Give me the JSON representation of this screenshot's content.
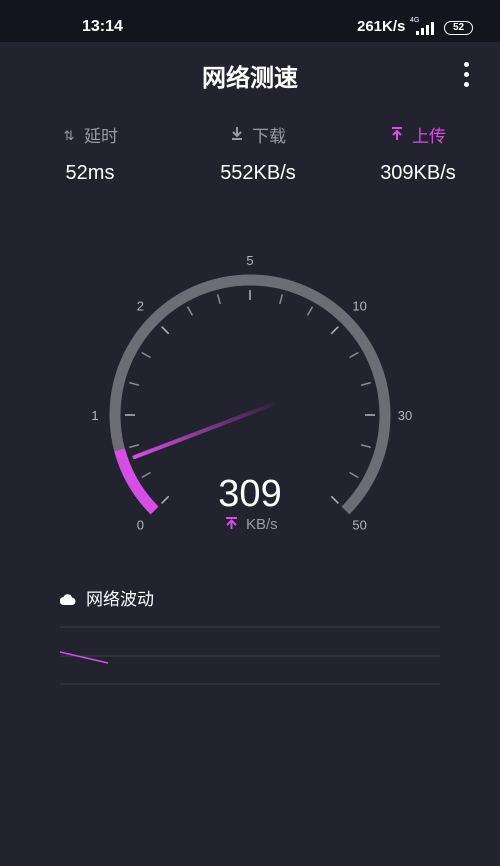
{
  "status_bar": {
    "time": "13:14",
    "net_speed": "261K/s",
    "network_type": "4G",
    "battery": "52"
  },
  "header": {
    "title": "网络测速"
  },
  "stats": {
    "latency": {
      "label": "延时",
      "value": "52ms",
      "icon": "latency-arrows-icon"
    },
    "download": {
      "label": "下载",
      "value": "552KB/s",
      "icon": "download-icon"
    },
    "upload": {
      "label": "上传",
      "value": "309KB/s",
      "icon": "upload-icon"
    }
  },
  "gauge": {
    "reading": "309",
    "unit": "KB/s",
    "scale_labels": [
      "0",
      "1",
      "2",
      "5",
      "10",
      "30",
      "50"
    ],
    "active_color": "#d64ee6",
    "track_color": "#6d6d76"
  },
  "fluctuation": {
    "title": "网络波动",
    "icon": "cloud-icon"
  },
  "colors": {
    "background": "#23232f",
    "accent": "#d64ee6",
    "muted": "#9a9aa3"
  }
}
